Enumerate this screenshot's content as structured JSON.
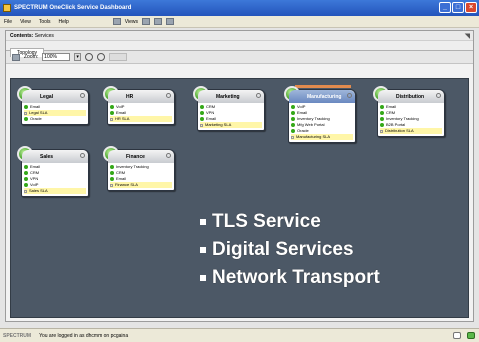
{
  "window": {
    "title": "SPECTRUM OneClick Service Dashboard"
  },
  "menu": [
    {
      "label": "File"
    },
    {
      "label": "View"
    },
    {
      "label": "Tools"
    },
    {
      "label": "Help"
    }
  ],
  "toolbar": {
    "history_label": "Views"
  },
  "contents": {
    "label": "Contents:",
    "value": "Services"
  },
  "tabs": [
    {
      "label": "Topology"
    }
  ],
  "zoom": {
    "label": "Zoom:",
    "value": "100%"
  },
  "nodes": [
    {
      "title": "Legal",
      "rows": [
        {
          "text": "Email",
          "sla": false
        },
        {
          "text": "Legal SLA",
          "sla": true
        },
        {
          "text": "Oracle",
          "sla": false
        }
      ]
    },
    {
      "title": "HR",
      "rows": [
        {
          "text": "VoIP",
          "sla": false
        },
        {
          "text": "Email",
          "sla": false
        },
        {
          "text": "HR SLA",
          "sla": true
        }
      ]
    },
    {
      "title": "Marketing",
      "rows": [
        {
          "text": "CRM",
          "sla": false
        },
        {
          "text": "VPN",
          "sla": false
        },
        {
          "text": "Email",
          "sla": false
        },
        {
          "text": "Marketing SLA",
          "sla": true
        }
      ]
    },
    {
      "title": "Manufacturing",
      "rows": [
        {
          "text": "VoIP",
          "sla": false
        },
        {
          "text": "Email",
          "sla": false
        },
        {
          "text": "Inventory Tracking",
          "sla": false
        },
        {
          "text": "Mfg Web Portal",
          "sla": false
        },
        {
          "text": "Oracle",
          "sla": false
        },
        {
          "text": "Manufacturing SLA",
          "sla": true
        }
      ]
    },
    {
      "title": "Distribution",
      "rows": [
        {
          "text": "Email",
          "sla": false
        },
        {
          "text": "CRM",
          "sla": false
        },
        {
          "text": "Inventory Tracking",
          "sla": false
        },
        {
          "text": "B2B Portal",
          "sla": false
        },
        {
          "text": "Distribution SLA",
          "sla": true
        }
      ]
    },
    {
      "title": "Sales",
      "rows": [
        {
          "text": "Email",
          "sla": false
        },
        {
          "text": "CRM",
          "sla": false
        },
        {
          "text": "VPN",
          "sla": false
        },
        {
          "text": "VoIP",
          "sla": false
        },
        {
          "text": "Sales SLA",
          "sla": true
        }
      ]
    },
    {
      "title": "Finance",
      "rows": [
        {
          "text": "Inventory Tracking",
          "sla": false
        },
        {
          "text": "CRM",
          "sla": false
        },
        {
          "text": "Email",
          "sla": false
        },
        {
          "text": "Finance SLA",
          "sla": true
        }
      ]
    }
  ],
  "bullets": [
    "TLS Service",
    "Digital Services",
    "Network Transport"
  ],
  "status": {
    "brand": "SPECTRUM",
    "message": "You are logged in as dhcmm on pcgaina"
  }
}
